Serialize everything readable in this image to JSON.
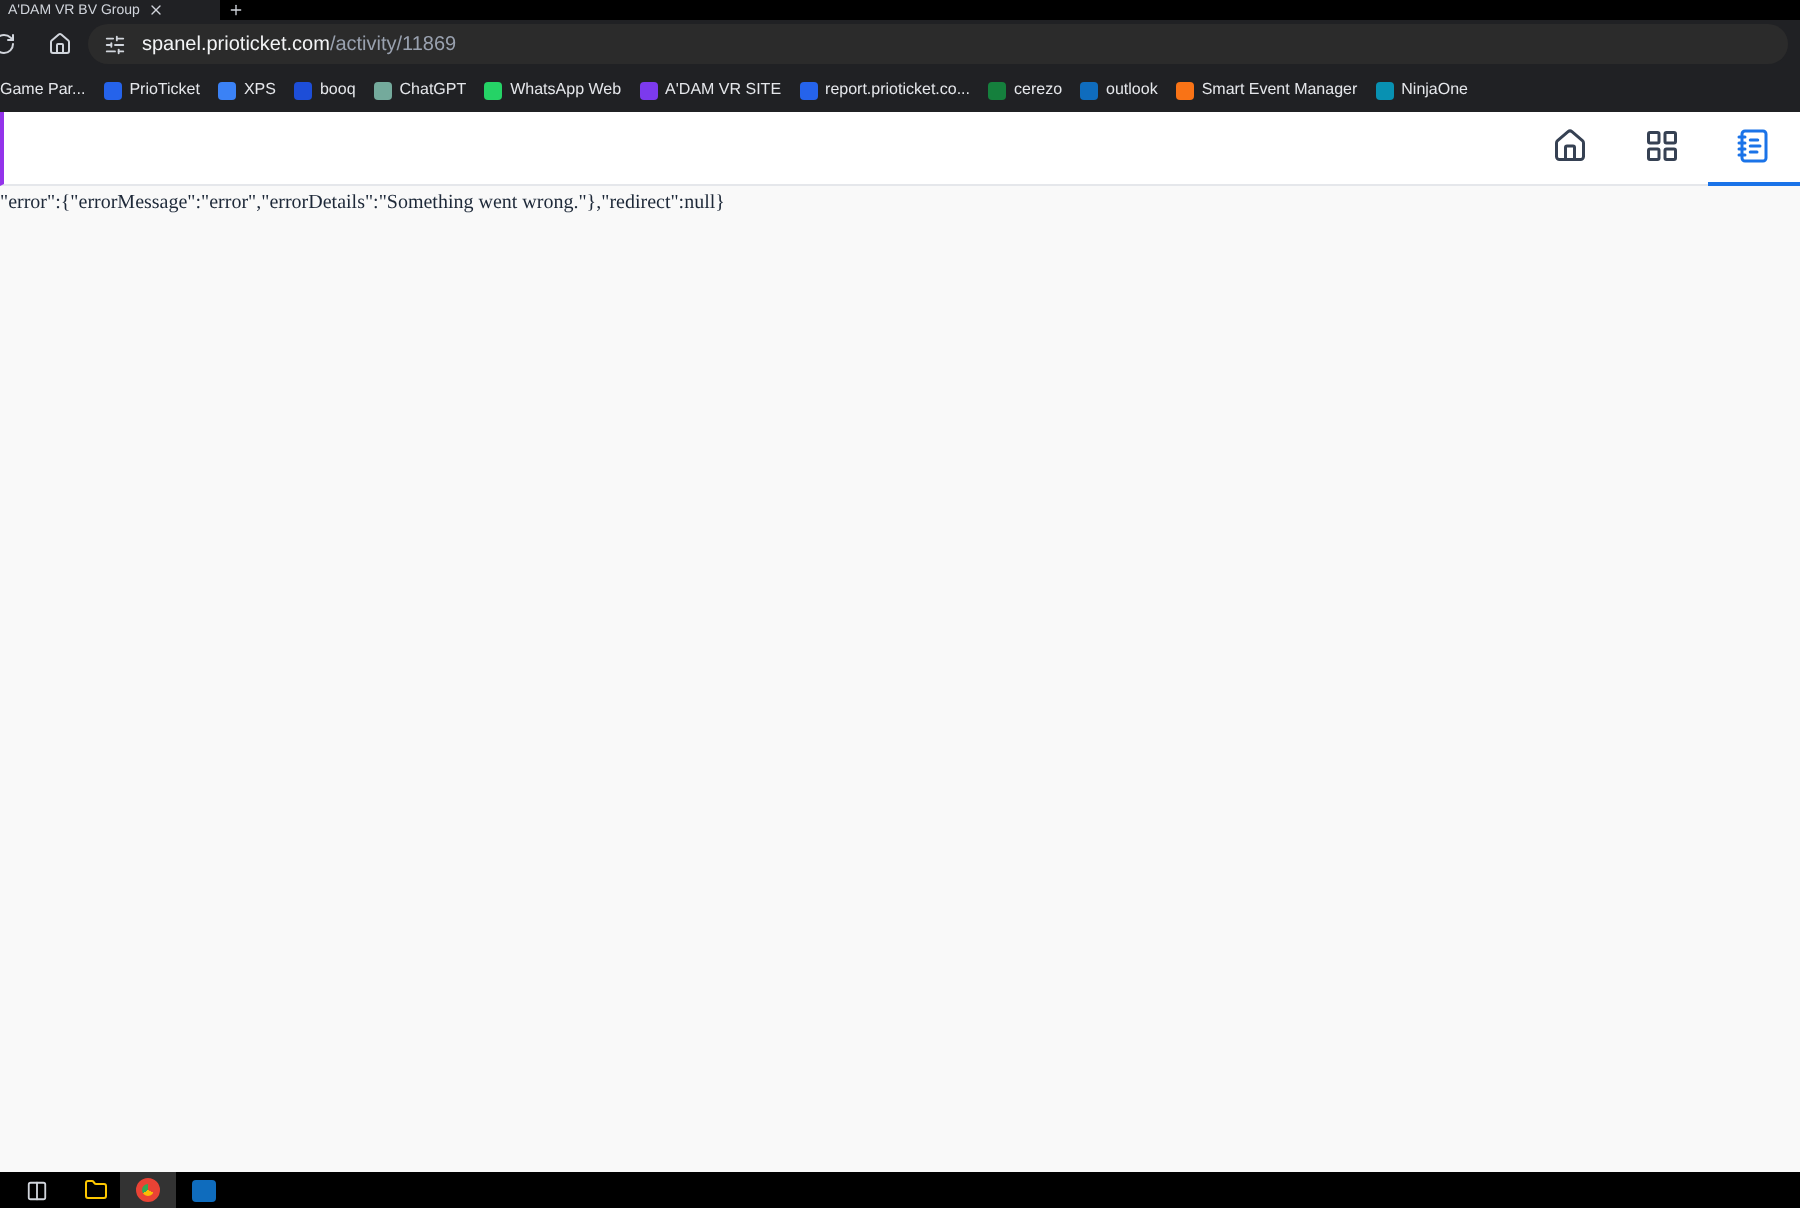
{
  "browser": {
    "tab_title": "A'DAM VR BV Group",
    "url_host": "spanel.prioticket.com",
    "url_path": "/activity/11869"
  },
  "bookmarks": [
    {
      "label": "Game Par..."
    },
    {
      "label": "PrioTicket",
      "color": "#2563eb"
    },
    {
      "label": "XPS",
      "color": "#3b82f6"
    },
    {
      "label": "booq",
      "color": "#1d4ed8"
    },
    {
      "label": "ChatGPT",
      "color": "#74aa9c"
    },
    {
      "label": "WhatsApp Web",
      "color": "#25d366"
    },
    {
      "label": "A'DAM VR SITE",
      "color": "#7c3aed"
    },
    {
      "label": "report.prioticket.co...",
      "color": "#2563eb"
    },
    {
      "label": "cerezo",
      "color": "#15803d"
    },
    {
      "label": "outlook",
      "color": "#0f6cbd"
    },
    {
      "label": "Smart Event Manager",
      "color": "#f97316"
    },
    {
      "label": "NinjaOne",
      "color": "#0891b2"
    }
  ],
  "nav": [
    {
      "kind": "home",
      "selected": false
    },
    {
      "kind": "grid",
      "selected": false
    },
    {
      "kind": "list",
      "selected": true
    }
  ],
  "body_text": "\"error\":{\"errorMessage\":\"error\",\"errorDetails\":\"Something went wrong.\"},\"redirect\":null}"
}
